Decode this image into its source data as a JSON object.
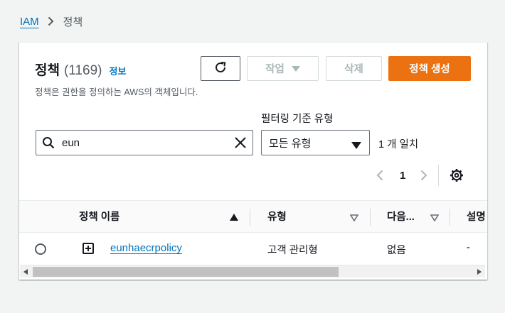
{
  "breadcrumb": {
    "root": "IAM",
    "current": "정책"
  },
  "header": {
    "title": "정책",
    "count": "(1169)",
    "info_link": "정보",
    "description": "정책은 권한을 정의하는 AWS의 객체입니다."
  },
  "toolbar": {
    "refresh_icon": "refresh-icon",
    "actions_label": "작업",
    "delete_label": "삭제",
    "create_label": "정책 생성"
  },
  "filter": {
    "label": "필터링 기준 유형",
    "search_value": "eun",
    "type_selected": "모든 유형",
    "match_text": "1 개 일치"
  },
  "pagination": {
    "current_page": "1"
  },
  "table": {
    "columns": [
      "정책 이름",
      "유형",
      "다음...",
      "설명"
    ],
    "rows": [
      {
        "name": "eunhaecrpolicy",
        "type": "고객 관리형",
        "used_as": "없음",
        "description": "-"
      }
    ]
  },
  "colors": {
    "link": "#0073bb",
    "primary": "#ec7211",
    "disabled": "#aab7b8",
    "text": "#16191f",
    "background": "#f2f3f3"
  }
}
